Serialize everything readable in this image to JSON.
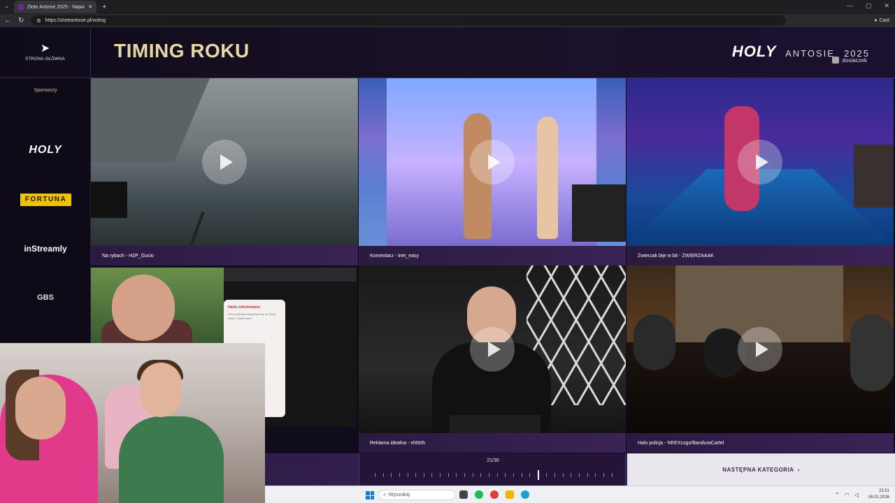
{
  "browser": {
    "tab_title": "Złote Antosie 2025 - Największy P",
    "url": "https://zloteantosie.pl/voting",
    "cast_label": "Cast"
  },
  "header": {
    "home_label": "STRONA GŁÓWNA",
    "category_title": "TIMING ROKU",
    "logo_text": "HOLY",
    "event_text": "ANTOSIE",
    "event_year": "2025",
    "streamer": "dosiaczek"
  },
  "sidebar": {
    "heading": "Sponsorzy",
    "sponsors": [
      "HOLY",
      "FORTUNA",
      "inStreamly",
      "GBS"
    ]
  },
  "videos": [
    {
      "label": "Na rybach - H2P_Gucio"
    },
    {
      "label": "Komentarz - inet_easy"
    },
    {
      "label": "Zwierzak bije w bit - ZWIERZAAAK"
    },
    {
      "label": ""
    },
    {
      "label": "Reklama idealna - xN0rth"
    },
    {
      "label": "Halo policja - NEEXcsgo/BanduraCartel"
    }
  ],
  "progress": {
    "text": "21/30",
    "current": 21,
    "total": 30
  },
  "next_button": {
    "label": "NASTĘPNA KATEGORIA"
  },
  "screenshare": {
    "popup_title": "Hasło zablokowane",
    "popup_text": "Ktoś próbował zalogować się na Twoje konto. Zmień hasło."
  },
  "taskbar": {
    "search_placeholder": "Wyszukaj",
    "time": "23:51",
    "date": "06.01.2026"
  },
  "colors": {
    "accent_gold": "#e9d7a4",
    "page_bg": "#100c1c",
    "caption_purple": "#3b2356",
    "fortuna_yellow": "#f2c200"
  }
}
